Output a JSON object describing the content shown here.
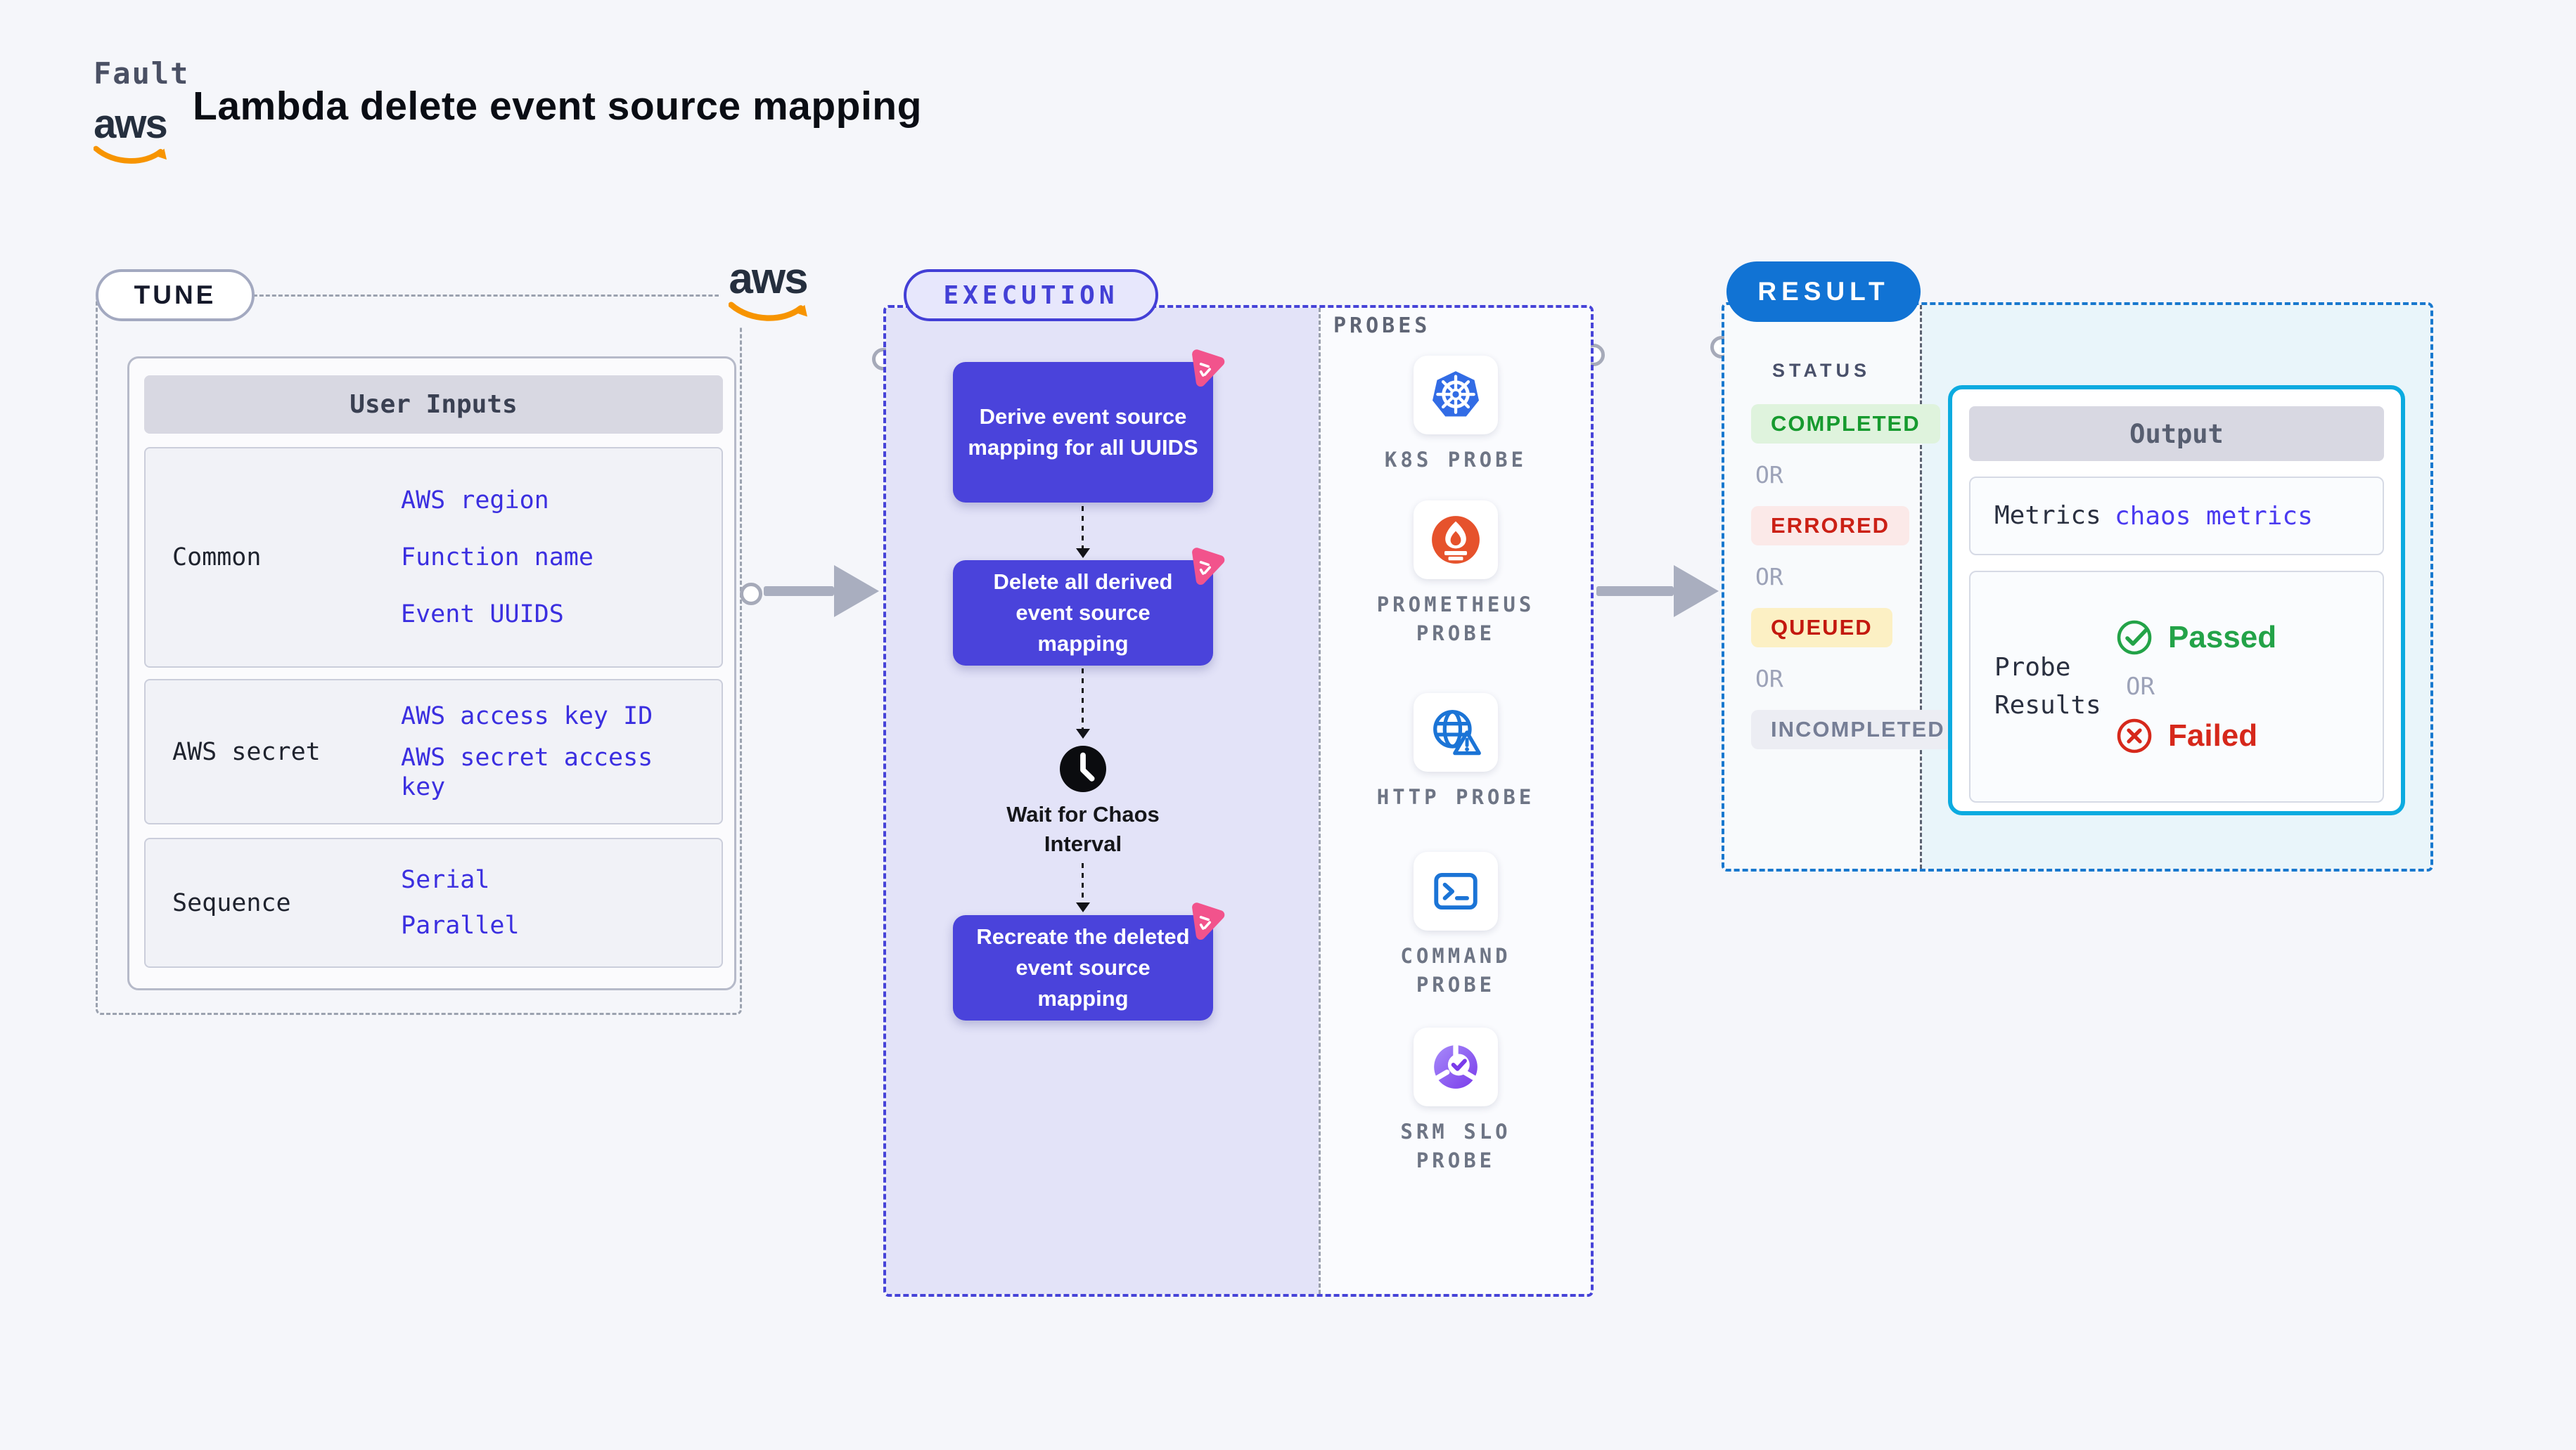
{
  "header": {
    "kicker": "Fault",
    "title": "Lambda delete event source mapping",
    "aws_logo_text": "aws"
  },
  "tune": {
    "badge": "TUNE",
    "aws_logo_text": "aws",
    "user_inputs": {
      "header": "User Inputs",
      "rows": [
        {
          "label": "Common",
          "values": [
            "AWS region",
            "Function name",
            "Event UUIDS"
          ]
        },
        {
          "label": "AWS secret",
          "values": [
            "AWS access key ID",
            "AWS secret access\nkey"
          ]
        },
        {
          "label": "Sequence",
          "values": [
            "Serial",
            "Parallel"
          ]
        }
      ]
    }
  },
  "execution": {
    "badge": "EXECUTION",
    "nodes": [
      {
        "label": "Derive event source\nmapping for all UUIDS"
      },
      {
        "label": "Delete all derived\nevent source\nmapping"
      },
      {
        "label": "Recreate the deleted\nevent source\nmapping"
      }
    ],
    "wait_label": "Wait for Chaos\nInterval",
    "probes_title": "PROBES",
    "probes": [
      {
        "name": "K8S PROBE",
        "icon": "kubernetes-icon"
      },
      {
        "name": "PROMETHEUS\nPROBE",
        "icon": "prometheus-icon"
      },
      {
        "name": "HTTP PROBE",
        "icon": "globe-warning-icon"
      },
      {
        "name": "COMMAND\nPROBE",
        "icon": "terminal-icon"
      },
      {
        "name": "SRM SLO\nPROBE",
        "icon": "slo-gauge-icon"
      }
    ]
  },
  "result": {
    "badge": "RESULT",
    "status_title": "STATUS",
    "or_label": "OR",
    "statuses": [
      {
        "label": "COMPLETED",
        "type": "completed"
      },
      {
        "label": "ERRORED",
        "type": "errored"
      },
      {
        "label": "QUEUED",
        "type": "queued"
      },
      {
        "label": "INCOMPLETED",
        "type": "incompleted"
      }
    ],
    "output": {
      "header": "Output",
      "metrics_label": "Metrics",
      "metrics_value": "chaos metrics",
      "probe_results_label": "Probe\nResults",
      "passed_label": "Passed",
      "or_label": "OR",
      "failed_label": "Failed"
    }
  },
  "colors": {
    "node_indigo": "#4A43DB",
    "execution_border": "#4643D8",
    "result_blue": "#1173D4",
    "result_border": "#1878CE",
    "output_border_cyan": "#0CABE0",
    "link_indigo": "#3B2FE0",
    "passed_green": "#23A348",
    "failed_red": "#D6281B",
    "chaos_pink": "#F2538C",
    "aws_orange": "#F79400",
    "kubernetes_blue": "#326CE5",
    "prometheus_orange": "#E6522C"
  }
}
